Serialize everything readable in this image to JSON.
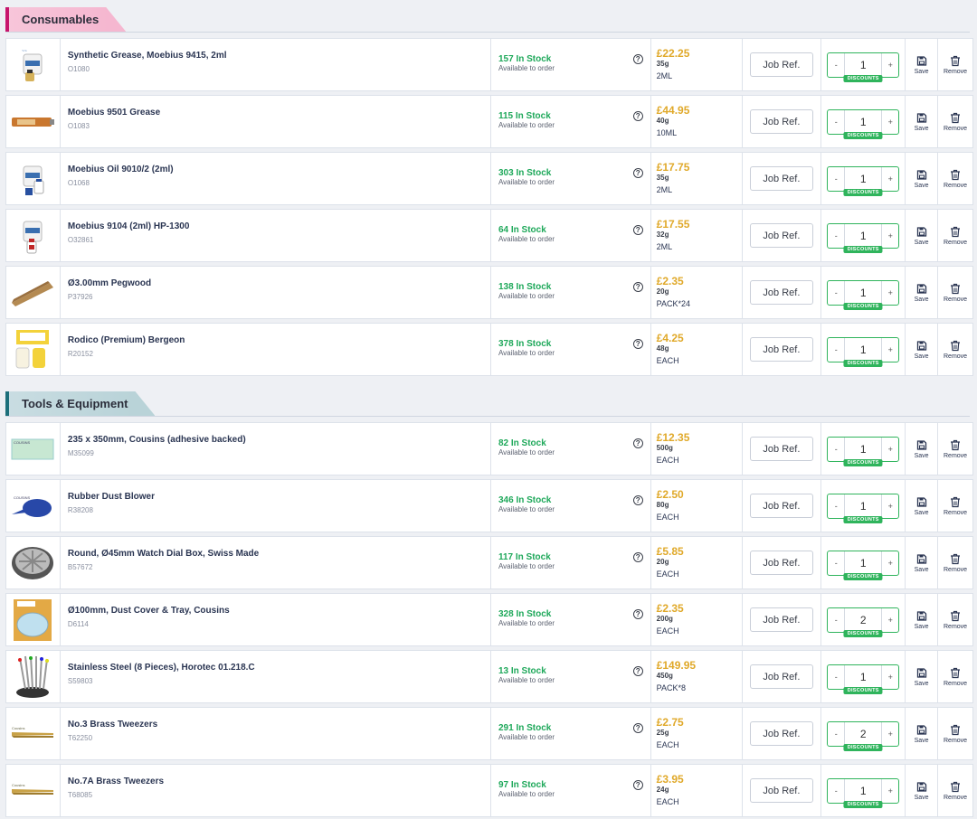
{
  "sections": [
    {
      "title": "Consumables",
      "items": [
        {
          "name": "Synthetic Grease, Moebius 9415, 2ml",
          "code": "O1080",
          "stock": "157 In Stock",
          "availability": "Available to order",
          "price": "£22.25",
          "weight": "35g",
          "unit": "2ML",
          "jobref_placeholder": "Job Ref.",
          "qty": "1",
          "discount": "DISCOUNTS",
          "save": "Save",
          "remove": "Remove",
          "image": "moebius-bottle"
        },
        {
          "name": "Moebius 9501 Grease",
          "code": "O1083",
          "stock": "115 In Stock",
          "availability": "Available to order",
          "price": "£44.95",
          "weight": "40g",
          "unit": "10ML",
          "jobref_placeholder": "Job Ref.",
          "qty": "1",
          "discount": "DISCOUNTS",
          "save": "Save",
          "remove": "Remove",
          "image": "grease-tube"
        },
        {
          "name": "Moebius Oil 9010/2 (2ml)",
          "code": "O1068",
          "stock": "303 In Stock",
          "availability": "Available to order",
          "price": "£17.75",
          "weight": "35g",
          "unit": "2ML",
          "jobref_placeholder": "Job Ref.",
          "qty": "1",
          "discount": "DISCOUNTS",
          "save": "Save",
          "remove": "Remove",
          "image": "moebius-bottle-blue"
        },
        {
          "name": "Moebius 9104 (2ml) HP-1300",
          "code": "O32861",
          "stock": "64 In Stock",
          "availability": "Available to order",
          "price": "£17.55",
          "weight": "32g",
          "unit": "2ML",
          "jobref_placeholder": "Job Ref.",
          "qty": "1",
          "discount": "DISCOUNTS",
          "save": "Save",
          "remove": "Remove",
          "image": "moebius-bottle-red"
        },
        {
          "name": "Ø3.00mm Pegwood",
          "code": "P37926",
          "stock": "138 In Stock",
          "availability": "Available to order",
          "price": "£2.35",
          "weight": "20g",
          "unit": "PACK*24",
          "jobref_placeholder": "Job Ref.",
          "qty": "1",
          "discount": "DISCOUNTS",
          "save": "Save",
          "remove": "Remove",
          "image": "pegwood"
        },
        {
          "name": "Rodico (Premium) Bergeon",
          "code": "R20152",
          "stock": "378 In Stock",
          "availability": "Available to order",
          "price": "£4.25",
          "weight": "48g",
          "unit": "EACH",
          "jobref_placeholder": "Job Ref.",
          "qty": "1",
          "discount": "DISCOUNTS",
          "save": "Save",
          "remove": "Remove",
          "image": "rodico"
        }
      ]
    },
    {
      "title": "Tools & Equipment",
      "items": [
        {
          "name": "235 x 350mm, Cousins (adhesive backed)",
          "code": "M35099",
          "stock": "82 In Stock",
          "availability": "Available to order",
          "price": "£12.35",
          "weight": "500g",
          "unit": "EACH",
          "jobref_placeholder": "Job Ref.",
          "qty": "1",
          "discount": "DISCOUNTS",
          "save": "Save",
          "remove": "Remove",
          "image": "mat"
        },
        {
          "name": "Rubber Dust Blower",
          "code": "R38208",
          "stock": "346 In Stock",
          "availability": "Available to order",
          "price": "£2.50",
          "weight": "80g",
          "unit": "EACH",
          "jobref_placeholder": "Job Ref.",
          "qty": "1",
          "discount": "DISCOUNTS",
          "save": "Save",
          "remove": "Remove",
          "image": "blower"
        },
        {
          "name": "Round, Ø45mm Watch Dial Box, Swiss Made",
          "code": "B57672",
          "stock": "117 In Stock",
          "availability": "Available to order",
          "price": "£5.85",
          "weight": "20g",
          "unit": "EACH",
          "jobref_placeholder": "Job Ref.",
          "qty": "1",
          "discount": "DISCOUNTS",
          "save": "Save",
          "remove": "Remove",
          "image": "dial-box"
        },
        {
          "name": "Ø100mm, Dust Cover & Tray, Cousins",
          "code": "D6114",
          "stock": "328 In Stock",
          "availability": "Available to order",
          "price": "£2.35",
          "weight": "200g",
          "unit": "EACH",
          "jobref_placeholder": "Job Ref.",
          "qty": "2",
          "discount": "DISCOUNTS",
          "save": "Save",
          "remove": "Remove",
          "image": "dust-cover"
        },
        {
          "name": "Stainless Steel (8 Pieces), Horotec 01.218.C",
          "code": "S59803",
          "stock": "13 In Stock",
          "availability": "Available to order",
          "price": "£149.95",
          "weight": "450g",
          "unit": "PACK*8",
          "jobref_placeholder": "Job Ref.",
          "qty": "1",
          "discount": "DISCOUNTS",
          "save": "Save",
          "remove": "Remove",
          "image": "screwdrivers"
        },
        {
          "name": "No.3 Brass Tweezers",
          "code": "T62250",
          "stock": "291 In Stock",
          "availability": "Available to order",
          "price": "£2.75",
          "weight": "25g",
          "unit": "EACH",
          "jobref_placeholder": "Job Ref.",
          "qty": "2",
          "discount": "DISCOUNTS",
          "save": "Save",
          "remove": "Remove",
          "image": "tweezers"
        },
        {
          "name": "No.7A Brass Tweezers",
          "code": "T68085",
          "stock": "97 In Stock",
          "availability": "Available to order",
          "price": "£3.95",
          "weight": "24g",
          "unit": "EACH",
          "jobref_placeholder": "Job Ref.",
          "qty": "1",
          "discount": "DISCOUNTS",
          "save": "Save",
          "remove": "Remove",
          "image": "tweezers"
        }
      ]
    }
  ],
  "colors": {
    "stock_green": "#1ea85a",
    "price_gold": "#e0a92a",
    "consumables_accent": "#c7146c",
    "tools_accent": "#1d6f7a"
  }
}
